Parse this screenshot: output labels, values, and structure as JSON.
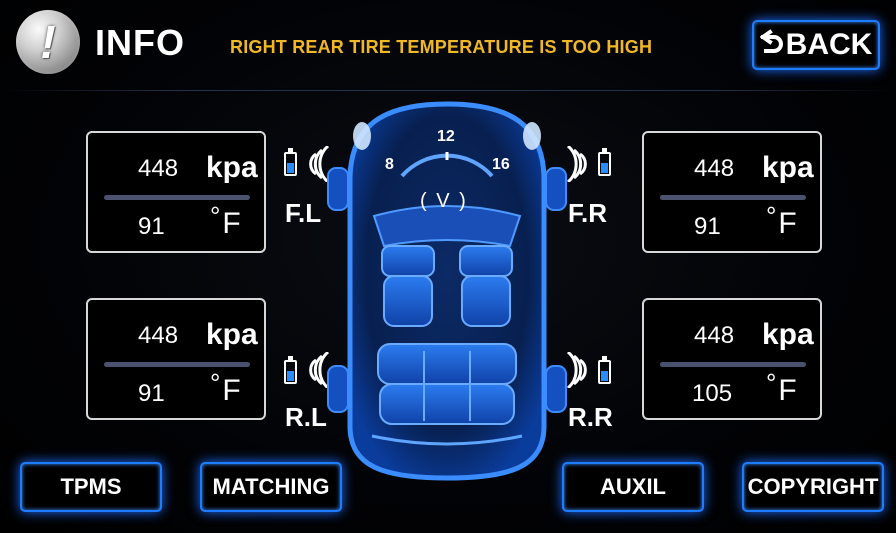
{
  "header": {
    "title": "INFO",
    "warning": "RIGHT REAR TIRE TEMPERATURE IS TOO HIGH",
    "back_label": "BACK",
    "info_icon_glyph": "!"
  },
  "tires": {
    "fl": {
      "label": "F.L",
      "pressure": "448",
      "pressure_unit": "kpa",
      "temp": "91",
      "temp_unit": "F"
    },
    "fr": {
      "label": "F.R",
      "pressure": "448",
      "pressure_unit": "kpa",
      "temp": "91",
      "temp_unit": "F"
    },
    "rl": {
      "label": "R.L",
      "pressure": "448",
      "pressure_unit": "kpa",
      "temp": "91",
      "temp_unit": "F"
    },
    "rr": {
      "label": "R.R",
      "pressure": "448",
      "pressure_unit": "kpa",
      "temp": "105",
      "temp_unit": "F"
    }
  },
  "degree_symbol": "°",
  "voltage_gauge": {
    "min": "8",
    "mid": "12",
    "max": "16",
    "unit_label": "( V )"
  },
  "buttons": {
    "tpms": "TPMS",
    "matching": "MATCHING",
    "auxil": "AUXIL",
    "copyright": "COPYRIGHT"
  },
  "icons": {
    "info": "info-icon",
    "back": "back-arrow-icon",
    "battery": "battery-icon",
    "signal": "signal-icon",
    "car": "car-top-view-icon"
  },
  "colors": {
    "accent_blue": "#1e7cff",
    "warning_yellow": "#f1b826",
    "background": "#000000",
    "car_blue": "#1a6fe0"
  }
}
